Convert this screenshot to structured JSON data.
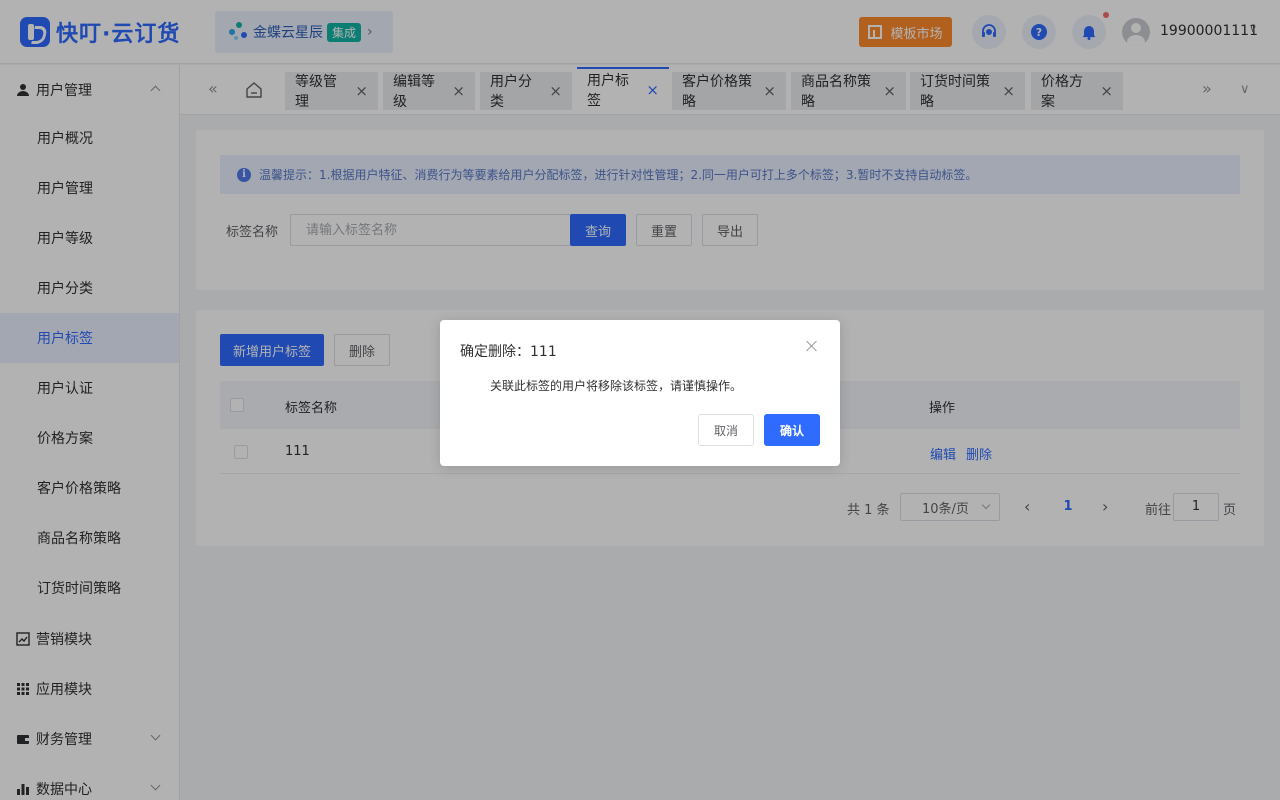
{
  "header": {
    "logo_text": "快叮·云订货",
    "integration_name": "金蝶云星辰",
    "integration_badge": "集成",
    "template_market": "模板市场",
    "user_name": "19900001111"
  },
  "sidebar": {
    "groups": [
      {
        "label": "用户管理",
        "expanded": true
      },
      {
        "label": "营销模块"
      },
      {
        "label": "应用模块"
      },
      {
        "label": "财务管理"
      },
      {
        "label": "数据中心"
      }
    ],
    "sub_items": [
      "用户概况",
      "用户管理",
      "用户等级",
      "用户分类",
      "用户标签",
      "用户认证",
      "价格方案",
      "客户价格策略",
      "商品名称策略",
      "订货时间策略"
    ],
    "active": "用户标签"
  },
  "tabs": [
    {
      "label": "等级管理"
    },
    {
      "label": "编辑等级"
    },
    {
      "label": "用户分类"
    },
    {
      "label": "用户标签",
      "active": true
    },
    {
      "label": "客户价格策略"
    },
    {
      "label": "商品名称策略"
    },
    {
      "label": "订货时间策略"
    },
    {
      "label": "价格方案"
    }
  ],
  "tip": {
    "text": "温馨提示：1.根据用户特征、消费行为等要素给用户分配标签，进行针对性管理；2.同一用户可打上多个标签；3.暂时不支持自动标签。"
  },
  "filter": {
    "label": "标签名称",
    "placeholder": "请输入标签名称",
    "search": "查询",
    "reset": "重置",
    "export": "导出"
  },
  "actions": {
    "add": "新增用户标签",
    "delete": "删除"
  },
  "table": {
    "columns": [
      "标签名称",
      "操作"
    ],
    "rows": [
      {
        "name": "111",
        "edit": "编辑",
        "delete": "删除"
      }
    ]
  },
  "pagination": {
    "total": "共 1 条",
    "page_size": "10条/页",
    "current": "1",
    "goto_prefix": "前往",
    "goto_value": "1",
    "goto_suffix": "页"
  },
  "modal": {
    "title": "确定删除：111",
    "message": "关联此标签的用户将移除该标签，请谨慎操作。",
    "cancel": "取消",
    "confirm": "确认"
  },
  "colors": {
    "primary": "#2f6bff",
    "market": "#ff8a2b",
    "badge": "#12b3a5",
    "notification_dot": "#f56c6c"
  }
}
